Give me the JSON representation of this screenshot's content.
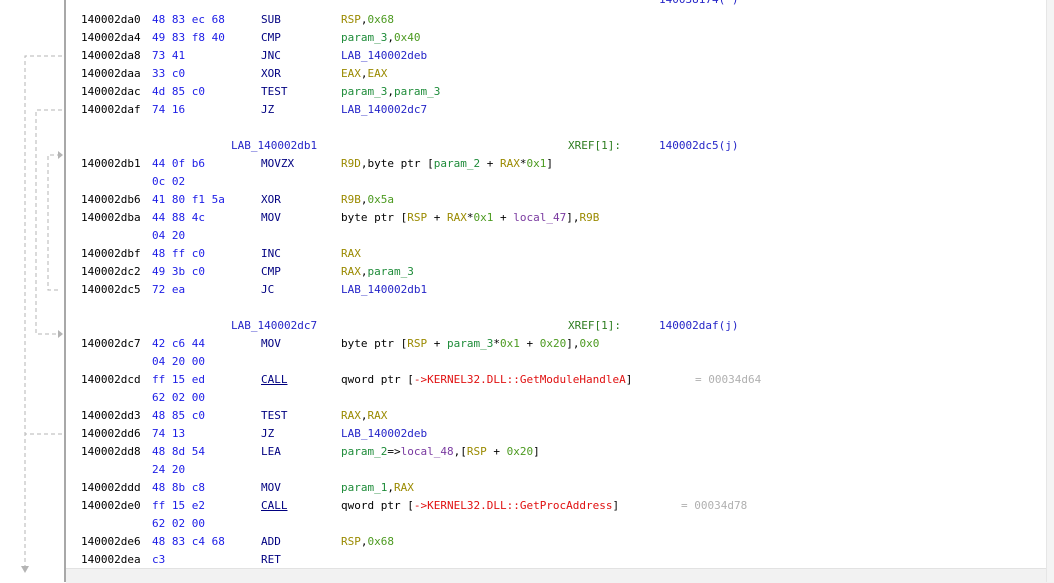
{
  "top_fragment": "140038174(*)",
  "rows": [
    {
      "addr": "140002da0",
      "bytes": "48 83 ec 68",
      "mn": "SUB",
      "ops": [
        [
          "RSP",
          "reg"
        ],
        [
          ",",
          ""
        ],
        [
          "0x68",
          "num"
        ]
      ]
    },
    {
      "addr": "140002da4",
      "bytes": "49 83 f8 40",
      "mn": "CMP",
      "ops": [
        [
          "param_3",
          "prm"
        ],
        [
          ",",
          ""
        ],
        [
          "0x40",
          "num"
        ]
      ]
    },
    {
      "addr": "140002da8",
      "bytes": "73 41",
      "mn": "JNC",
      "ops": [
        [
          "LAB_140002deb",
          "blu"
        ]
      ]
    },
    {
      "addr": "140002daa",
      "bytes": "33 c0",
      "mn": "XOR",
      "ops": [
        [
          "EAX",
          "reg"
        ],
        [
          ",",
          ""
        ],
        [
          "EAX",
          "reg"
        ]
      ]
    },
    {
      "addr": "140002dac",
      "bytes": "4d 85 c0",
      "mn": "TEST",
      "ops": [
        [
          "param_3",
          "prm"
        ],
        [
          ",",
          ""
        ],
        [
          "param_3",
          "prm"
        ]
      ]
    },
    {
      "addr": "140002daf",
      "bytes": "74 16",
      "mn": "JZ",
      "ops": [
        [
          "LAB_140002dc7",
          "blu"
        ]
      ]
    },
    {
      "label": "LAB_140002db1",
      "xref": "XREF[1]:",
      "xval": "140002dc5(j)"
    },
    {
      "addr": "140002db1",
      "bytes": "44 0f b6",
      "mn": "MOVZX",
      "ops": [
        [
          "R9D",
          "reg"
        ],
        [
          ",byte ptr [",
          ""
        ],
        [
          "param_2",
          "prm"
        ],
        [
          " + ",
          ""
        ],
        [
          "RAX",
          "reg"
        ],
        [
          "*",
          ""
        ],
        [
          "0x1",
          "num"
        ],
        [
          "]",
          ""
        ]
      ]
    },
    {
      "cont": "0c 02"
    },
    {
      "addr": "140002db6",
      "bytes": "41 80 f1 5a",
      "mn": "XOR",
      "ops": [
        [
          "R9B",
          "reg"
        ],
        [
          ",",
          ""
        ],
        [
          "0x5a",
          "num"
        ]
      ]
    },
    {
      "addr": "140002dba",
      "bytes": "44 88 4c",
      "mn": "MOV",
      "ops": [
        [
          "byte ptr [",
          ""
        ],
        [
          "RSP",
          "reg"
        ],
        [
          " + ",
          ""
        ],
        [
          "RAX",
          "reg"
        ],
        [
          "*",
          ""
        ],
        [
          "0x1",
          "num"
        ],
        [
          " + ",
          ""
        ],
        [
          "local_47",
          "loc"
        ],
        [
          "],",
          ""
        ],
        [
          "R9B",
          "reg"
        ]
      ]
    },
    {
      "cont": "04 20"
    },
    {
      "addr": "140002dbf",
      "bytes": "48 ff c0",
      "mn": "INC",
      "ops": [
        [
          "RAX",
          "reg"
        ]
      ]
    },
    {
      "addr": "140002dc2",
      "bytes": "49 3b c0",
      "mn": "CMP",
      "ops": [
        [
          "RAX",
          "reg"
        ],
        [
          ",",
          ""
        ],
        [
          "param_3",
          "prm"
        ]
      ]
    },
    {
      "addr": "140002dc5",
      "bytes": "72 ea",
      "mn": "JC",
      "ops": [
        [
          "LAB_140002db1",
          "blu"
        ]
      ]
    },
    {
      "label": "LAB_140002dc7",
      "xref": "XREF[1]:",
      "xval": "140002daf(j)"
    },
    {
      "addr": "140002dc7",
      "bytes": "42 c6 44",
      "mn": "MOV",
      "ops": [
        [
          "byte ptr [",
          ""
        ],
        [
          "RSP",
          "reg"
        ],
        [
          " + ",
          ""
        ],
        [
          "param_3",
          "prm"
        ],
        [
          "*",
          ""
        ],
        [
          "0x1",
          "num"
        ],
        [
          " + ",
          ""
        ],
        [
          "0x20",
          "num"
        ],
        [
          "],",
          ""
        ],
        [
          "0x0",
          "num"
        ]
      ]
    },
    {
      "cont": "04 20 00"
    },
    {
      "addr": "140002dcd",
      "bytes": "ff 15 ed",
      "mn": "CALL",
      "ul": true,
      "ops": [
        [
          "qword ptr [",
          ""
        ],
        [
          "->KERNEL32.DLL::GetModuleHandleA",
          "red"
        ],
        [
          "]",
          ""
        ]
      ],
      "cmt": "= 00034d64",
      "cmtx": 629
    },
    {
      "cont": "62 02 00"
    },
    {
      "addr": "140002dd3",
      "bytes": "48 85 c0",
      "mn": "TEST",
      "ops": [
        [
          "RAX",
          "reg"
        ],
        [
          ",",
          ""
        ],
        [
          "RAX",
          "reg"
        ]
      ]
    },
    {
      "addr": "140002dd6",
      "bytes": "74 13",
      "mn": "JZ",
      "ops": [
        [
          "LAB_140002deb",
          "blu"
        ]
      ]
    },
    {
      "addr": "140002dd8",
      "bytes": "48 8d 54",
      "mn": "LEA",
      "ops": [
        [
          "param_2",
          "prm"
        ],
        [
          "=>",
          ""
        ],
        [
          "local_48",
          "loc"
        ],
        [
          ",[",
          ""
        ],
        [
          "RSP",
          "reg"
        ],
        [
          " + ",
          ""
        ],
        [
          "0x20",
          "num"
        ],
        [
          "]",
          ""
        ]
      ]
    },
    {
      "cont": "24 20"
    },
    {
      "addr": "140002ddd",
      "bytes": "48 8b c8",
      "mn": "MOV",
      "ops": [
        [
          "param_1",
          "prm"
        ],
        [
          ",",
          ""
        ],
        [
          "RAX",
          "reg"
        ]
      ]
    },
    {
      "addr": "140002de0",
      "bytes": "ff 15 e2",
      "mn": "CALL",
      "ul": true,
      "ops": [
        [
          "qword ptr [",
          ""
        ],
        [
          "->KERNEL32.DLL::GetProcAddress",
          "red"
        ],
        [
          "]",
          ""
        ]
      ],
      "cmt": "= 00034d78",
      "cmtx": 615
    },
    {
      "cont": "62 02 00"
    },
    {
      "addr": "140002de6",
      "bytes": "48 83 c4 68",
      "mn": "ADD",
      "ops": [
        [
          "RSP",
          "reg"
        ],
        [
          ",",
          ""
        ],
        [
          "0x68",
          "num"
        ]
      ]
    },
    {
      "addr": "140002dea",
      "bytes": "c3",
      "mn": "RET",
      "ops": []
    }
  ]
}
